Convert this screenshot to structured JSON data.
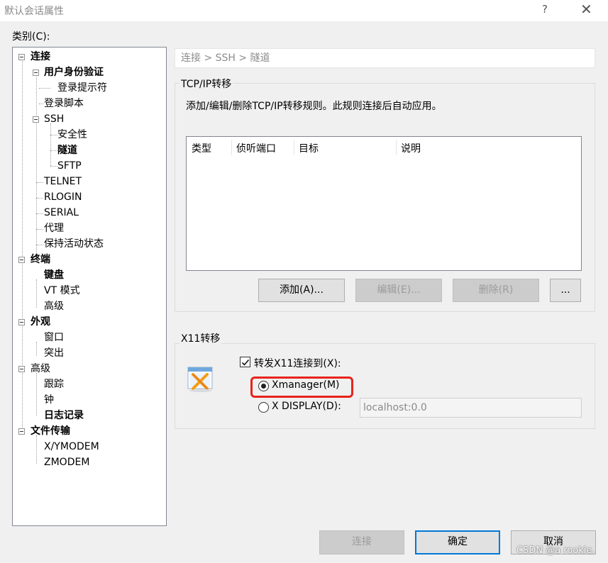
{
  "window": {
    "title": "默认会话属性",
    "help_glyph": "?",
    "close_glyph": "✕"
  },
  "category_label": "类别(C):",
  "tree": {
    "connection": "连接",
    "user_auth": "用户身份验证",
    "login_prompt": "登录提示符",
    "login_script": "登录脚本",
    "ssh": "SSH",
    "security": "安全性",
    "tunnel": "隧道",
    "sftp": "SFTP",
    "telnet": "TELNET",
    "rlogin": "RLOGIN",
    "serial": "SERIAL",
    "proxy": "代理",
    "keepalive": "保持活动状态",
    "terminal": "终端",
    "keyboard": "键盘",
    "vt_mode": "VT 模式",
    "terminal_advanced": "高级",
    "appearance": "外观",
    "window": "窗口",
    "highlight": "突出",
    "advanced": "高级",
    "trace": "跟踪",
    "bell": "钟",
    "logging": "日志记录",
    "file_transfer": "文件传输",
    "xymodem": "X/YMODEM",
    "zmodem": "ZMODEM"
  },
  "breadcrumb": "连接 > SSH > 隧道",
  "tcpip": {
    "group_title": "TCP/IP转移",
    "description": "添加/编辑/删除TCP/IP转移规则。此规则连接后自动应用。",
    "columns": [
      "类型",
      "侦听端口",
      "目标",
      "说明"
    ],
    "add_label": "添加(A)...",
    "edit_label": "编辑(E)...",
    "delete_label": "删除(R)",
    "more_label": "..."
  },
  "x11": {
    "group_title": "X11转移",
    "forward_label": "转发X11连接到(X):",
    "forward_checked": true,
    "xmanager_label": "Xmanager(M)",
    "xdisplay_label": "X DISPLAY(D):",
    "selected": "xmanager",
    "display_value": "localhost:0.0"
  },
  "footer": {
    "connect_label": "连接",
    "ok_label": "确定",
    "cancel_label": "取消"
  },
  "watermark": "CSDN @a rookie.",
  "colors": {
    "highlight_border": "#e8231b",
    "focus_border": "#0078d7"
  }
}
